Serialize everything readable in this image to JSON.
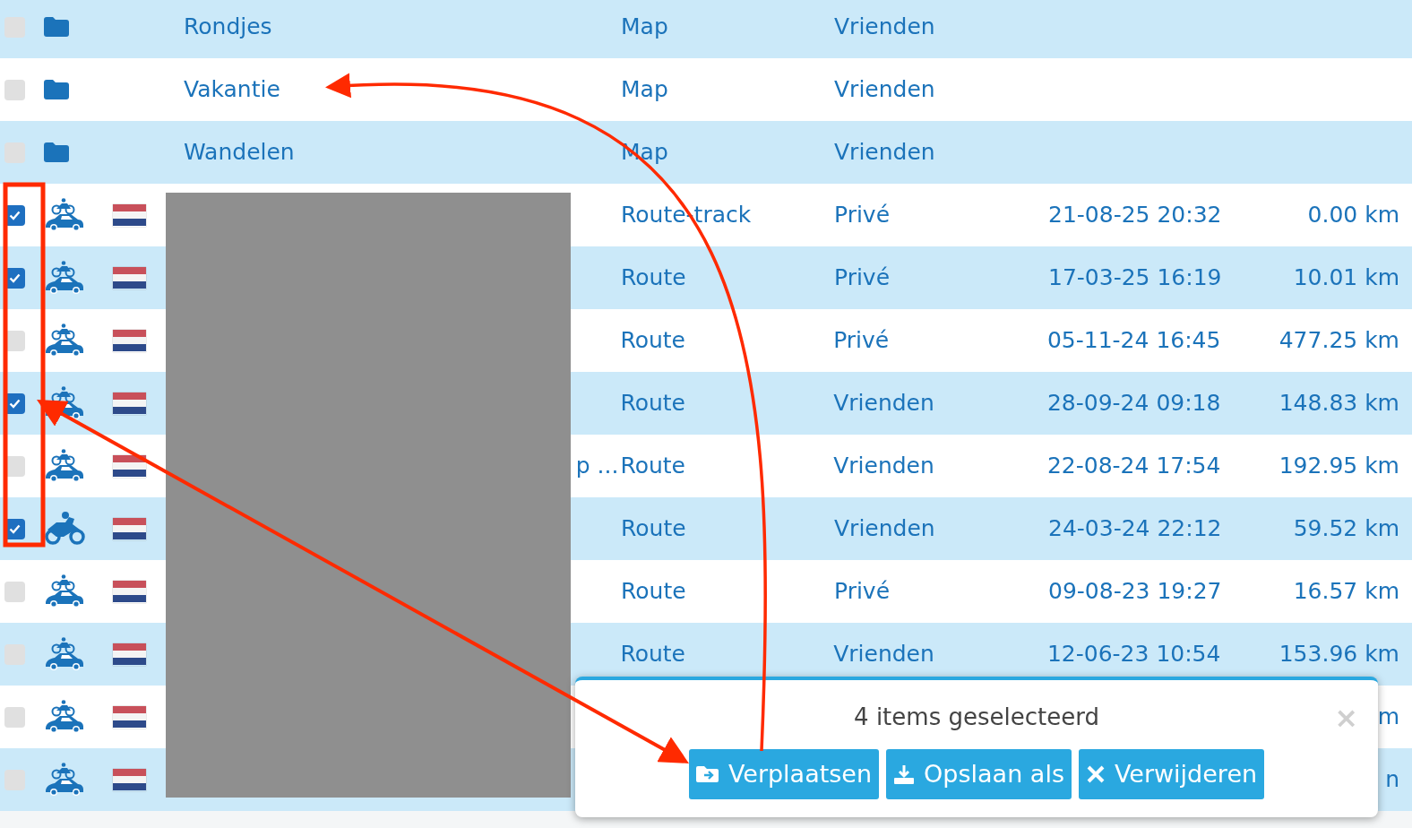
{
  "rows": [
    {
      "kind": "folder",
      "checked": false,
      "name": "Rondjes",
      "type": "Map",
      "sharing": "Vrienden"
    },
    {
      "kind": "folder",
      "checked": false,
      "name": "Vakantie",
      "type": "Map",
      "sharing": "Vrienden"
    },
    {
      "kind": "folder",
      "checked": false,
      "name": "Wandelen",
      "type": "Map",
      "sharing": "Vrienden"
    },
    {
      "kind": "moto-car",
      "checked": true,
      "type": "Route-track",
      "sharing": "Privé",
      "date": "21-08-25 20:32",
      "distance": "0.00 km"
    },
    {
      "kind": "moto-car",
      "checked": true,
      "type": "Route",
      "sharing": "Privé",
      "date": "17-03-25 16:19",
      "distance": "10.01 km"
    },
    {
      "kind": "moto-car",
      "checked": false,
      "type": "Route",
      "sharing": "Privé",
      "date": "05-11-24 16:45",
      "distance": "477.25 km"
    },
    {
      "kind": "moto-car",
      "checked": true,
      "type": "Route",
      "sharing": "Vrienden",
      "date": "28-09-24 09:18",
      "distance": "148.83 km"
    },
    {
      "kind": "moto-car",
      "checked": false,
      "name": "p ...",
      "type": "Route",
      "sharing": "Vrienden",
      "date": "22-08-24 17:54",
      "distance": "192.95 km"
    },
    {
      "kind": "motorcycle",
      "checked": true,
      "type": "Route",
      "sharing": "Vrienden",
      "date": "24-03-24 22:12",
      "distance": "59.52 km"
    },
    {
      "kind": "moto-car",
      "checked": false,
      "type": "Route",
      "sharing": "Privé",
      "date": "09-08-23 19:27",
      "distance": "16.57 km"
    },
    {
      "kind": "moto-car",
      "checked": false,
      "type": "Route",
      "sharing": "Vrienden",
      "date": "12-06-23 10:54",
      "distance": "153.96 km"
    },
    {
      "kind": "moto-car",
      "checked": false,
      "distance": "m"
    },
    {
      "kind": "moto-car",
      "checked": false,
      "distance": "n"
    }
  ],
  "selection_bar": {
    "title": "4 items geselecteerd",
    "close": "×",
    "buttons": [
      {
        "kind": "move",
        "label": "Verplaatsen"
      },
      {
        "kind": "download",
        "label": "Opslaan als"
      },
      {
        "kind": "delete",
        "label": "Verwijderen"
      }
    ]
  }
}
